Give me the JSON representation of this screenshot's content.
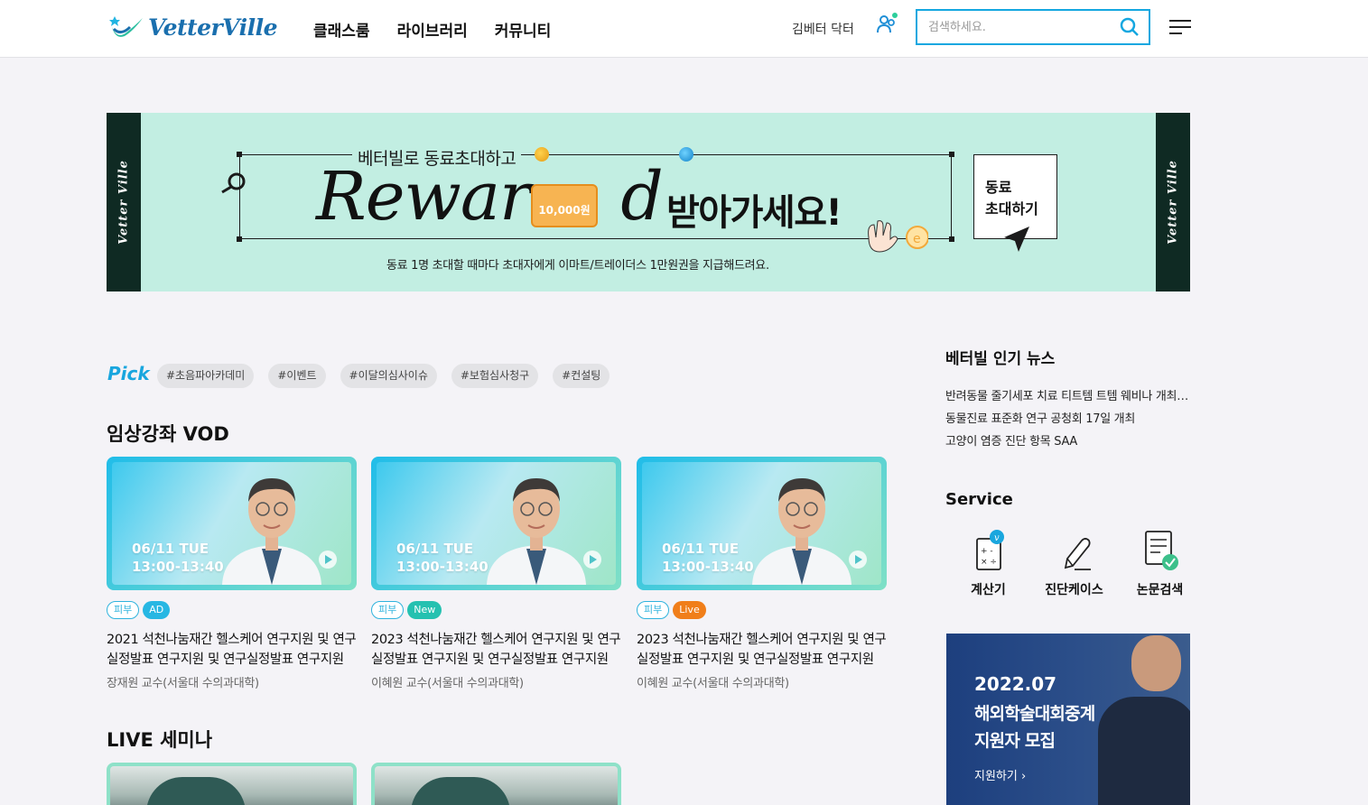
{
  "header": {
    "logo": "VetterVille",
    "nav": [
      "클래스룸",
      "라이브러리",
      "커뮤니티"
    ],
    "user_name": "김베터 닥터",
    "search_placeholder": "검색하세요."
  },
  "banner": {
    "strip_text": "Vetter Ville",
    "top_text": "베터빌로 동료초대하고",
    "reward_left": "Rewar",
    "reward_right": "d",
    "voucher": "10,000원",
    "big_text": "받아가세요!",
    "sub_text": "동료 1명 초대할 때마다 초대자에게 이마트/트레이더스 1만원권을 지급해드려요.",
    "invite_button": [
      "동료",
      "초대하기"
    ]
  },
  "pick": {
    "label": "Pick",
    "tags": [
      "#초음파아카데미",
      "#이벤트",
      "#이달의심사이슈",
      "#보험심사청구",
      "#컨설팅"
    ]
  },
  "vod": {
    "title": "임상강좌 VOD",
    "cards": [
      {
        "date": "06/11  TUE",
        "time": "13:00-13:40",
        "category": "피부",
        "badge": "AD",
        "title": "2021 석천나눔재간 헬스케어 연구지원 및 연구실정발표 연구지원 및 연구실정발표 연구지원",
        "author": "장재원 교수(서울대 수의과대학)"
      },
      {
        "date": "06/11  TUE",
        "time": "13:00-13:40",
        "category": "피부",
        "badge": "New",
        "title": "2023 석천나눔재간 헬스케어 연구지원 및 연구실정발표 연구지원 및 연구실정발표 연구지원",
        "author": "이혜원 교수(서울대 수의과대학)"
      },
      {
        "date": "06/11  TUE",
        "time": "13:00-13:40",
        "category": "피부",
        "badge": "Live",
        "title": "2023 석천나눔재간 헬스케어 연구지원 및 연구실정발표 연구지원 및 연구실정발표 연구지원",
        "author": "이혜원 교수(서울대 수의과대학)"
      }
    ]
  },
  "live": {
    "title": "LIVE 세미나"
  },
  "news": {
    "title": "베터빌 인기 뉴스",
    "items": [
      "반려동물 줄기세포 치료 티트템 트템 웨비나 개최 안내",
      "동물진료 표준화 연구 공청회 17일 개최",
      "고양이 염증 진단 항목 SAA"
    ]
  },
  "service": {
    "title": "Service",
    "items": [
      {
        "label": "계산기",
        "icon": "calculator-icon"
      },
      {
        "label": "진단케이스",
        "icon": "pencil-icon"
      },
      {
        "label": "논문검색",
        "icon": "document-check-icon"
      }
    ]
  },
  "promo": {
    "year": "2022.07",
    "line1": "해외학술대회중계",
    "line2": "지원자 모집",
    "cta": "지원하기 ›"
  },
  "colors": {
    "accent": "#14a7e0",
    "banner_bg": "#c2eee2",
    "live_badge": "#f07e1a",
    "new_badge": "#25c1b0"
  }
}
